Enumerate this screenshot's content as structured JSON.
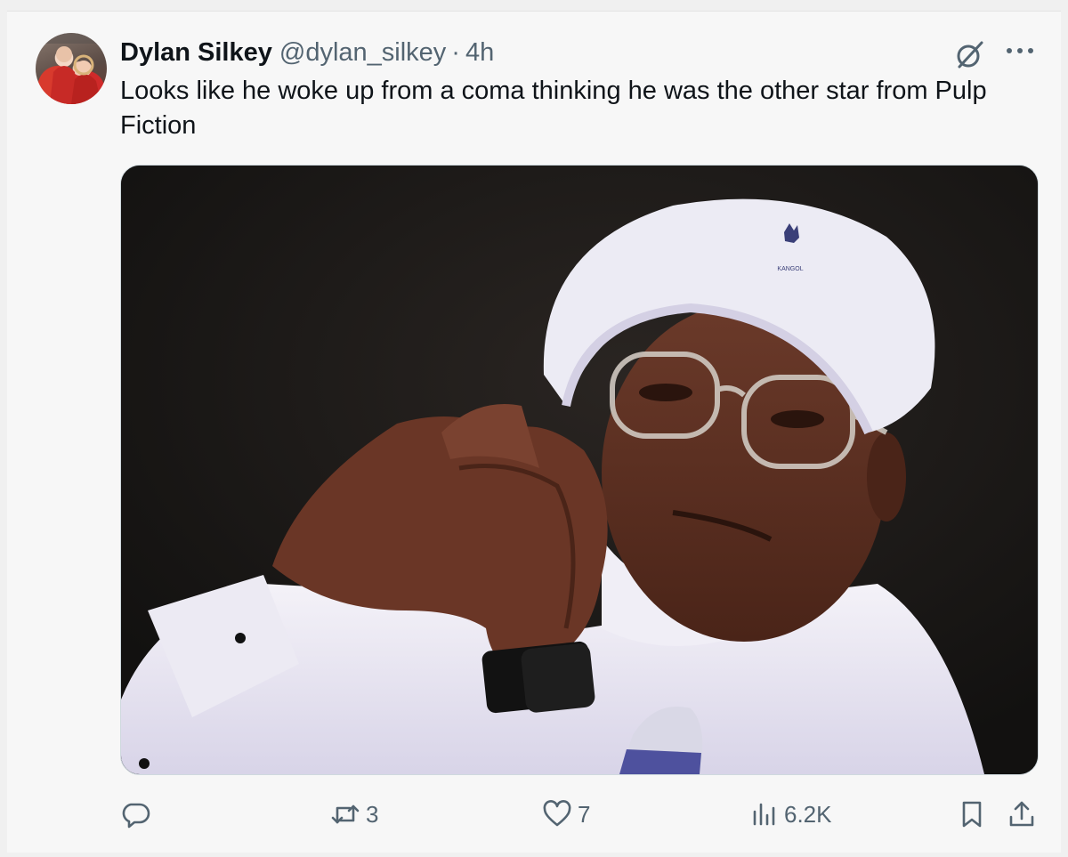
{
  "tweet": {
    "display_name": "Dylan Silkey",
    "handle": "@dylan_silkey",
    "separator": "·",
    "time": "4h",
    "text": "Looks like he woke up from a coma thinking he was the other star from Pulp Fiction",
    "avatar_icon": "profile-photo",
    "media_alt": "photo",
    "hat_logo_text": "KANGOL"
  },
  "actions": {
    "reply": {
      "icon": "reply-icon",
      "count": ""
    },
    "retweet": {
      "icon": "retweet-icon",
      "count": "3"
    },
    "like": {
      "icon": "heart-icon",
      "count": "7"
    },
    "views": {
      "icon": "views-icon",
      "count": "6.2K"
    },
    "bookmark": {
      "icon": "bookmark-icon"
    },
    "share": {
      "icon": "share-icon"
    }
  },
  "colors": {
    "text": "#0f1419",
    "secondary": "#536471",
    "background": "#f7f7f7"
  }
}
